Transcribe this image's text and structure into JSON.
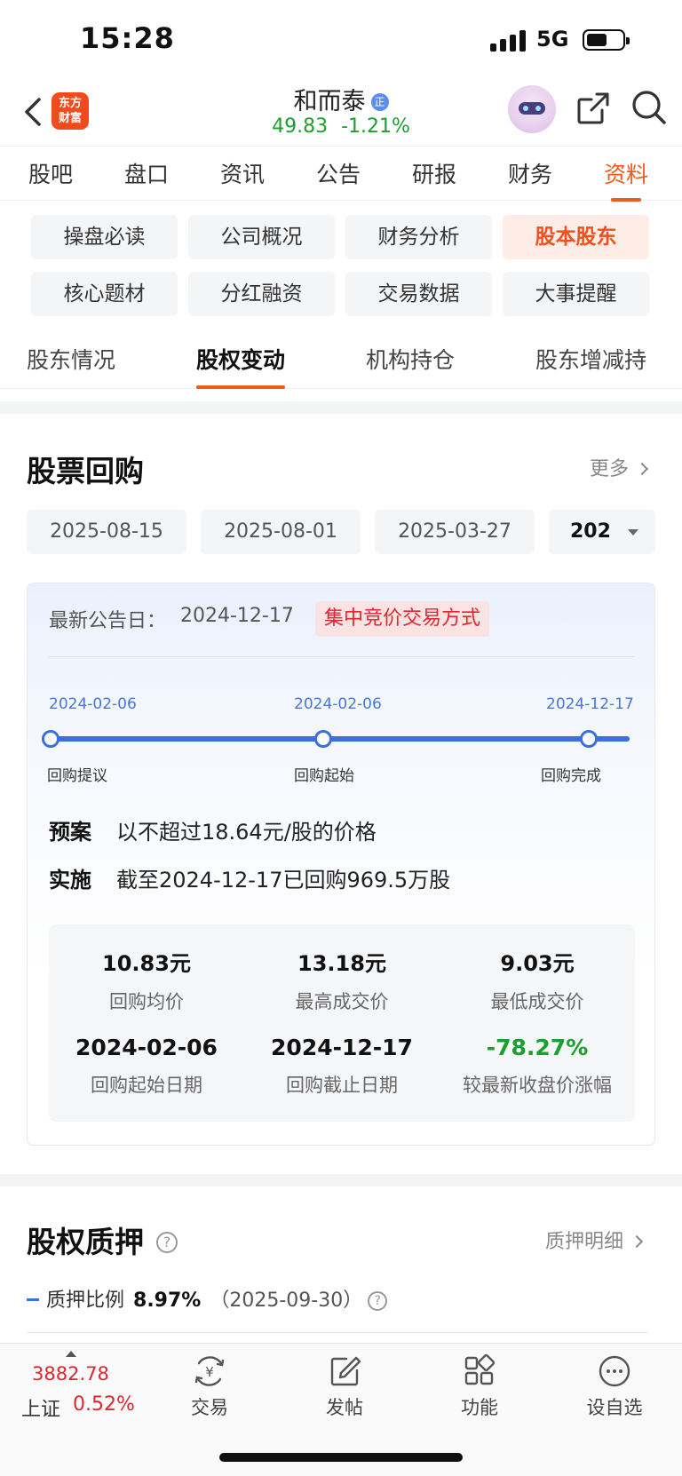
{
  "status": {
    "time": "15:28",
    "network": "5G"
  },
  "header": {
    "logo_text_1": "东方",
    "logo_text_2": "财富",
    "stock_name": "和而泰",
    "badge": "正",
    "price": "49.83",
    "change_pct": "-1.21%"
  },
  "main_tabs": [
    "股吧",
    "盘口",
    "资讯",
    "公告",
    "研报",
    "财务",
    "资料"
  ],
  "active_main_tab": "资料",
  "sub_buttons": [
    "操盘必读",
    "公司概况",
    "财务分析",
    "股本股东",
    "核心题材",
    "分红融资",
    "交易数据",
    "大事提醒"
  ],
  "active_sub_button": "股本股东",
  "sub_tabs": [
    "股东情况",
    "股权变动",
    "机构持仓",
    "股东增减持"
  ],
  "active_sub_tab": "股权变动",
  "buyback": {
    "title": "股票回购",
    "more": "更多",
    "dates": [
      "2025-08-15",
      "2025-08-01",
      "2025-03-27",
      "202"
    ],
    "notice_label": "最新公告日：",
    "notice_date": "2024-12-17",
    "method": "集中竞价交易方式",
    "timeline": {
      "dates": [
        "2024-02-06",
        "2024-02-06",
        "2024-12-17"
      ],
      "labels": [
        "回购提议",
        "回购起始",
        "回购完成"
      ]
    },
    "plan_label": "预案",
    "plan_text": "以不超过18.64元/股的价格",
    "impl_label": "实施",
    "impl_text": "截至2024-12-17已回购969.5万股",
    "stats": [
      {
        "value": "10.83元",
        "label": "回购均价"
      },
      {
        "value": "13.18元",
        "label": "最高成交价"
      },
      {
        "value": "9.03元",
        "label": "最低成交价"
      },
      {
        "value": "2024-02-06",
        "label": "回购起始日期"
      },
      {
        "value": "2024-12-17",
        "label": "回购截止日期"
      },
      {
        "value": "-78.27%",
        "label": "较最新收盘价涨幅"
      }
    ]
  },
  "pledge": {
    "title": "股权质押",
    "detail": "质押明细",
    "ratio_label": "质押比例",
    "ratio_value": "8.97%",
    "ratio_date": "（2025-09-30）"
  },
  "bottom": {
    "index_value": "3882.78",
    "index_name": "上证",
    "index_pct": "0.52%",
    "nav": [
      "交易",
      "发帖",
      "功能",
      "设自选"
    ]
  },
  "colors": {
    "accent": "#f05a1c",
    "up": "#e0262f",
    "down": "#1aa02e",
    "timeline": "#3c6fe0"
  }
}
